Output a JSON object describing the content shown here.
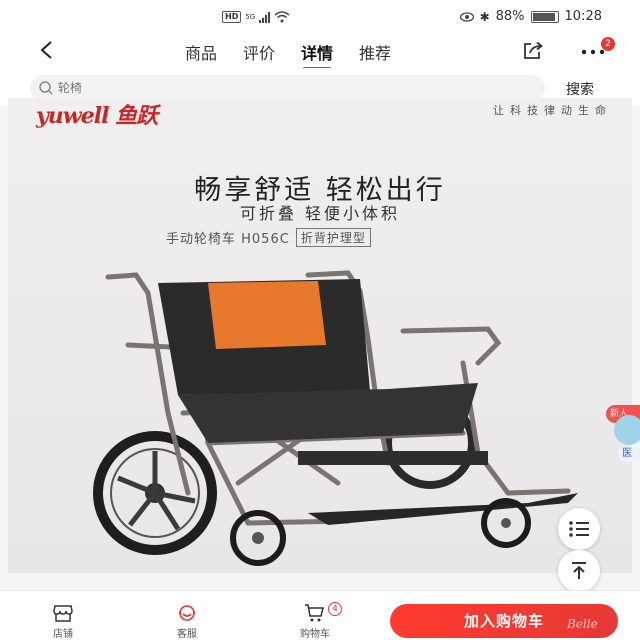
{
  "status_bar": {
    "network_badge": "HD",
    "network_type": "5G",
    "battery": "88%",
    "time": "10:28"
  },
  "nav": {
    "tabs": [
      {
        "label": "商品"
      },
      {
        "label": "评价"
      },
      {
        "label": "详情"
      },
      {
        "label": "推荐"
      }
    ],
    "active_tab": "详情",
    "more_badge": "2"
  },
  "search": {
    "placeholder": "轮椅",
    "button_label": "搜索"
  },
  "product": {
    "brand": "yuwell 鱼跃",
    "slogan": "让科技律动生命",
    "headline": "畅享舒适  轻松出行",
    "subline": "可折叠  轻便小体积",
    "model": "手动轮椅车 H056C",
    "model_tag": "折背护理型",
    "accent_color": "#e8782c"
  },
  "side": {
    "badge": "新人",
    "badge2": "医"
  },
  "bottom_bar": {
    "shop_label": "店铺",
    "service_label": "客服",
    "cart_label": "购物车",
    "cart_count": "4",
    "add_to_cart": "加入购物车",
    "watermark": "Belle"
  },
  "colors": {
    "brand_red": "#e53935",
    "wheelchair_frame": "#7a7470",
    "seat_fabric": "#2b2b2b"
  }
}
